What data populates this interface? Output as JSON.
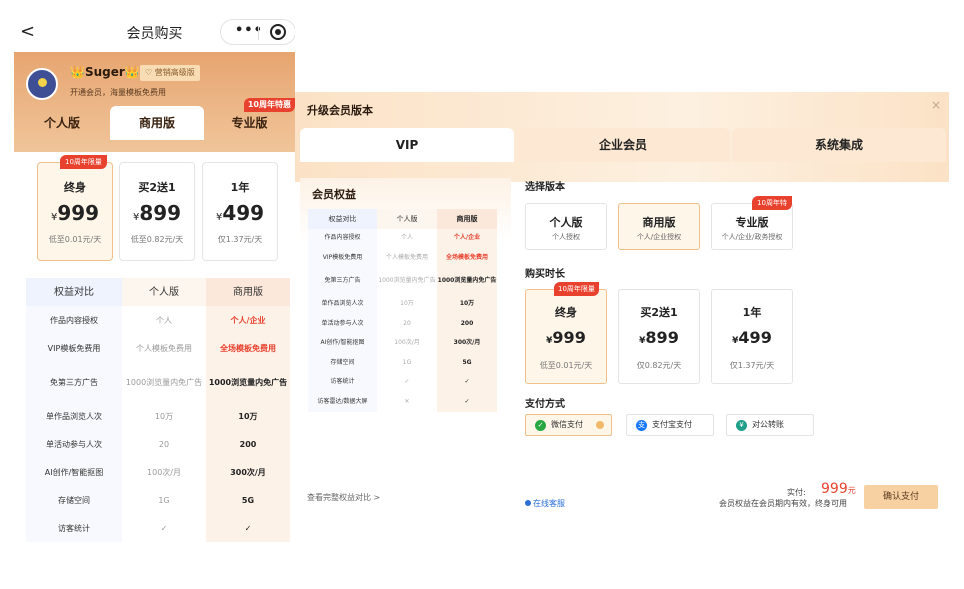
{
  "mobile": {
    "nav": {
      "back_glyph": "<",
      "title": "会员购买",
      "menu_glyph": "•••"
    },
    "user": {
      "name": "👑Suger👑",
      "badge": "营销高级版",
      "subtitle": "开通会员，海量模板免费用"
    },
    "tabs": [
      {
        "label": "个人版",
        "tag": ""
      },
      {
        "label": "商用版",
        "tag": ""
      },
      {
        "label": "专业版",
        "tag": "10周年特惠"
      }
    ],
    "active_tab": 1,
    "plans": [
      {
        "tag": "10周年限量",
        "name": "终身",
        "currency": "¥",
        "price": "999",
        "desc": "低至0.01元/天"
      },
      {
        "tag": "",
        "name": "买2送1",
        "currency": "¥",
        "price": "899",
        "desc": "低至0.82元/天"
      },
      {
        "tag": "",
        "name": "1年",
        "currency": "¥",
        "price": "499",
        "desc": "仅1.37元/天"
      }
    ],
    "table": {
      "headers": [
        "权益对比",
        "个人版",
        "商用版"
      ],
      "rows": [
        [
          "作品内容授权",
          "个人",
          "个人/企业"
        ],
        [
          "VIP模板免费用",
          "个人模板免费用",
          "全场模板免费用"
        ],
        [
          "免第三方广告",
          "1000浏览量内免广告",
          "1000浏览量内免广告"
        ],
        [
          "单作品浏览人次",
          "10万",
          "10万"
        ],
        [
          "单活动参与人次",
          "20",
          "200"
        ],
        [
          "AI创作/智能抠图",
          "100次/月",
          "300次/月"
        ],
        [
          "存储空间",
          "1G",
          "5G"
        ],
        [
          "访客统计",
          "✓",
          "✓"
        ]
      ]
    }
  },
  "desktop": {
    "title": "升级会员版本",
    "close_glyph": "×",
    "tabs": [
      "VIP",
      "企业会员",
      "系统集成"
    ],
    "active_tab": 0,
    "benefits": {
      "title": "会员权益",
      "headers": [
        "权益对比",
        "个人版",
        "商用版"
      ],
      "rows": [
        [
          "作品内容授权",
          "个人",
          "个人/企业"
        ],
        [
          "VIP模板免费用",
          "个人模板免费用",
          "全场模板免费用"
        ],
        [
          "免第三方广告",
          "1000浏览量内免广告",
          "1000浏览量内免广告"
        ],
        [
          "单作品浏览人次",
          "10万",
          "10万"
        ],
        [
          "单活动参与人次",
          "20",
          "200"
        ],
        [
          "AI创作/智能抠图",
          "100次/月",
          "300次/月"
        ],
        [
          "存储空间",
          "1G",
          "5G"
        ],
        [
          "访客统计",
          "✓",
          "✓"
        ],
        [
          "访客雷达/数据大屏",
          "✕",
          "✓"
        ]
      ],
      "full_link": "查看完整权益对比 >"
    },
    "version_label": "选择版本",
    "versions": [
      {
        "name": "个人版",
        "desc": "个人授权",
        "tag": ""
      },
      {
        "name": "商用版",
        "desc": "个人/企业授权",
        "tag": ""
      },
      {
        "name": "专业版",
        "desc": "个人/企业/政务授权",
        "tag": "10周年特惠"
      }
    ],
    "duration_label": "购买时长",
    "plans": [
      {
        "tag": "10周年限量",
        "name": "终身",
        "currency": "¥",
        "price": "999",
        "desc": "低至0.01元/天"
      },
      {
        "tag": "",
        "name": "买2送1",
        "currency": "¥",
        "price": "899",
        "desc": "仅0.82元/天"
      },
      {
        "tag": "",
        "name": "1年",
        "currency": "¥",
        "price": "499",
        "desc": "仅1.37元/天"
      }
    ],
    "payment_label": "支付方式",
    "payments": [
      {
        "label": "微信支付",
        "icon": "wechat-icon",
        "color": "#27a843"
      },
      {
        "label": "支付宝支付",
        "icon": "alipay-icon",
        "color": "#1677ff"
      },
      {
        "label": "对公转账",
        "icon": "bank-transfer-icon",
        "color": "#1f9f8a"
      }
    ],
    "service": "在线客服",
    "paid_label": "实付:",
    "amount": "999",
    "amount_unit": "元",
    "note": "会员权益在会员期内有效，终身可用",
    "confirm": "确认支付"
  },
  "colors": {
    "accent": "#e8422f",
    "gold": "#f0c08c",
    "header_orange": "#e7a570"
  }
}
